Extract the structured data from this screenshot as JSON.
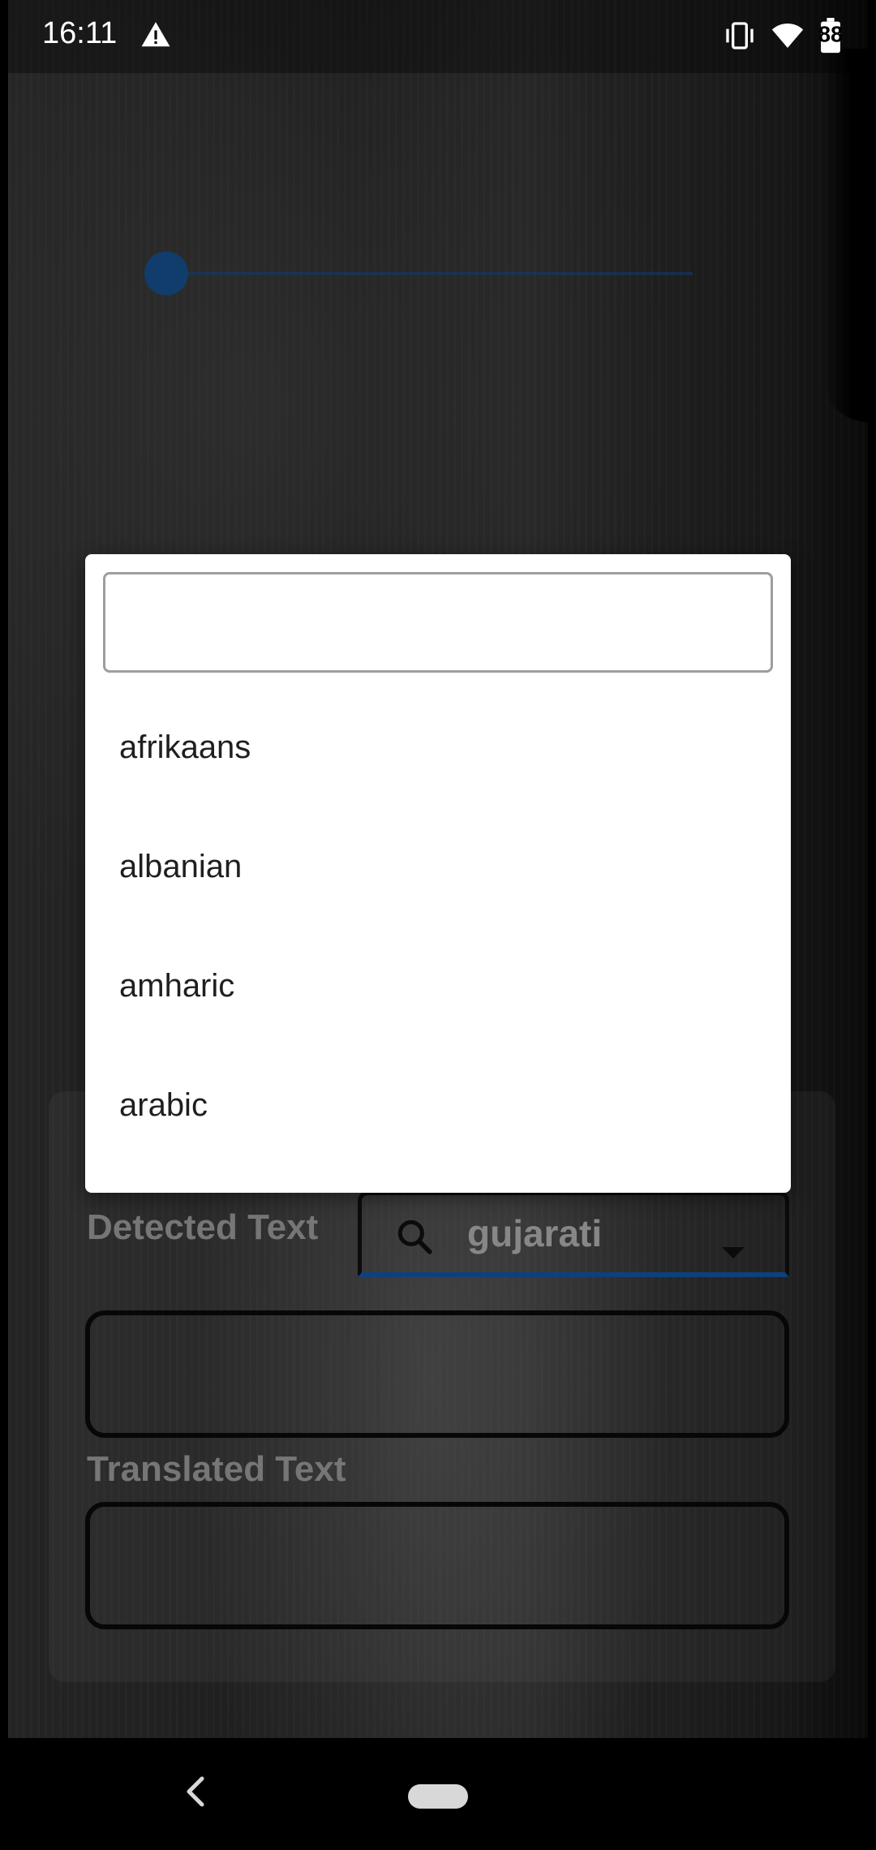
{
  "status_bar": {
    "time": "16:11",
    "battery_level": "88",
    "icons": [
      "warning-icon",
      "vibrate-icon",
      "wifi-icon",
      "battery-icon"
    ]
  },
  "slider": {
    "value_fraction": 0.0,
    "accent_color": "#1a5fa6"
  },
  "panel": {
    "detected_label": "Detected Text",
    "language_selected": "gujarati",
    "translated_label": "Translated Text",
    "detected_value": "",
    "translated_value": ""
  },
  "dropdown": {
    "search_value": "",
    "items": [
      "afrikaans",
      "albanian",
      "amharic",
      "arabic"
    ]
  },
  "colors": {
    "accent": "#1565c0",
    "dialog_bg": "#ffffff"
  }
}
